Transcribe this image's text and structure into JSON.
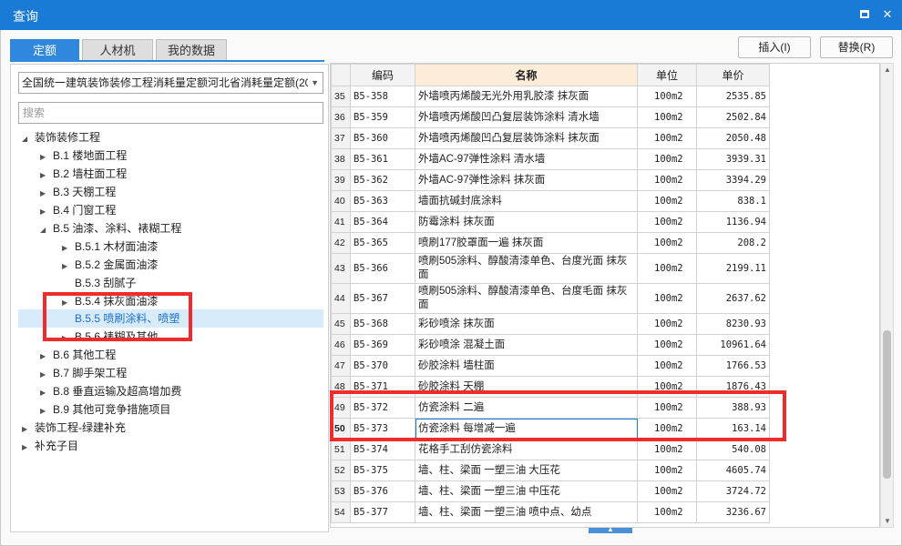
{
  "window": {
    "title": "查询"
  },
  "tabs": [
    "定额",
    "人材机",
    "我的数据"
  ],
  "actions": {
    "insert": "插入(I)",
    "replace": "替换(R)"
  },
  "quota_library": {
    "selected": "全国统一建筑装饰装修工程消耗量定额河北省消耗量定额(20"
  },
  "search": {
    "placeholder": "搜索"
  },
  "tree": [
    {
      "label": "装饰装修工程",
      "arrow": "◢"
    },
    {
      "label": "B.1 楼地面工程",
      "arrow": "▶"
    },
    {
      "label": "B.2 墙柱面工程",
      "arrow": "▶"
    },
    {
      "label": "B.3 天棚工程",
      "arrow": "▶"
    },
    {
      "label": "B.4 门窗工程",
      "arrow": "▶"
    },
    {
      "label": "B.5 油漆、涂料、裱糊工程",
      "arrow": "◢"
    },
    {
      "label": "B.5.1 木材面油漆",
      "arrow": "▶"
    },
    {
      "label": "B.5.2 金属面油漆",
      "arrow": "▶"
    },
    {
      "label": "B.5.3 刮腻子",
      "arrow": ""
    },
    {
      "label": "B.5.4 抹灰面油漆",
      "arrow": "▶"
    },
    {
      "label": "B.5.5 喷刷涂料、喷塑",
      "arrow": ""
    },
    {
      "label": "B.5.6 裱糊及其他",
      "arrow": "▶"
    },
    {
      "label": "B.6 其他工程",
      "arrow": "▶"
    },
    {
      "label": "B.7 脚手架工程",
      "arrow": "▶"
    },
    {
      "label": "B.8 垂直运输及超高增加费",
      "arrow": "▶"
    },
    {
      "label": "B.9 其他可竞争措施项目",
      "arrow": "▶"
    },
    {
      "label": "装饰工程-绿建补充",
      "arrow": "▶"
    },
    {
      "label": "补充子目",
      "arrow": "▶"
    }
  ],
  "grid": {
    "headers": {
      "code": "编码",
      "name": "名称",
      "unit": "单位",
      "price": "单价"
    },
    "rows": [
      {
        "no": "35",
        "code": "B5-358",
        "name": "外墙喷丙烯酸无光外用乳胶漆 抹灰面",
        "unit": "100m2",
        "price": "2535.85"
      },
      {
        "no": "36",
        "code": "B5-359",
        "name": "外墙喷丙烯酸凹凸复层装饰涂料 清水墙",
        "unit": "100m2",
        "price": "2502.84"
      },
      {
        "no": "37",
        "code": "B5-360",
        "name": "外墙喷丙烯酸凹凸复层装饰涂料 抹灰面",
        "unit": "100m2",
        "price": "2050.48"
      },
      {
        "no": "38",
        "code": "B5-361",
        "name": "外墙AC-97弹性涂料 清水墙",
        "unit": "100m2",
        "price": "3939.31"
      },
      {
        "no": "39",
        "code": "B5-362",
        "name": "外墙AC-97弹性涂料 抹灰面",
        "unit": "100m2",
        "price": "3394.29"
      },
      {
        "no": "40",
        "code": "B5-363",
        "name": "墙面抗碱封底涂料",
        "unit": "100m2",
        "price": "838.1"
      },
      {
        "no": "41",
        "code": "B5-364",
        "name": "防霉涂料 抹灰面",
        "unit": "100m2",
        "price": "1136.94"
      },
      {
        "no": "42",
        "code": "B5-365",
        "name": "喷刷177胶罩面一遍 抹灰面",
        "unit": "100m2",
        "price": "208.2"
      },
      {
        "no": "43",
        "code": "B5-366",
        "name": "喷刷505涂料、醇酸清漆单色、台度光面 抹灰面",
        "unit": "100m2",
        "price": "2199.11"
      },
      {
        "no": "44",
        "code": "B5-367",
        "name": "喷刷505涂料、醇酸清漆单色、台度毛面 抹灰面",
        "unit": "100m2",
        "price": "2637.62"
      },
      {
        "no": "45",
        "code": "B5-368",
        "name": "彩砂喷涂 抹灰面",
        "unit": "100m2",
        "price": "8230.93"
      },
      {
        "no": "46",
        "code": "B5-369",
        "name": "彩砂喷涂 混凝土面",
        "unit": "100m2",
        "price": "10961.64"
      },
      {
        "no": "47",
        "code": "B5-370",
        "name": "砂胶涂料 墙柱面",
        "unit": "100m2",
        "price": "1766.53"
      },
      {
        "no": "48",
        "code": "B5-371",
        "name": "砂胶涂料 天棚",
        "unit": "100m2",
        "price": "1876.43"
      },
      {
        "no": "49",
        "code": "B5-372",
        "name": "仿瓷涂料 二遍",
        "unit": "100m2",
        "price": "388.93"
      },
      {
        "no": "50",
        "code": "B5-373",
        "name": "仿瓷涂料 每增减一遍",
        "unit": "100m2",
        "price": "163.14"
      },
      {
        "no": "51",
        "code": "B5-374",
        "name": "花格手工刮仿瓷涂料",
        "unit": "100m2",
        "price": "540.08"
      },
      {
        "no": "52",
        "code": "B5-375",
        "name": "墙、柱、梁面 一塑三油 大压花",
        "unit": "100m2",
        "price": "4605.74"
      },
      {
        "no": "53",
        "code": "B5-376",
        "name": "墙、柱、梁面 一塑三油 中压花",
        "unit": "100m2",
        "price": "3724.72"
      },
      {
        "no": "54",
        "code": "B5-377",
        "name": "墙、柱、梁面 一塑三油 喷中点、幼点",
        "unit": "100m2",
        "price": "3236.67"
      }
    ]
  }
}
